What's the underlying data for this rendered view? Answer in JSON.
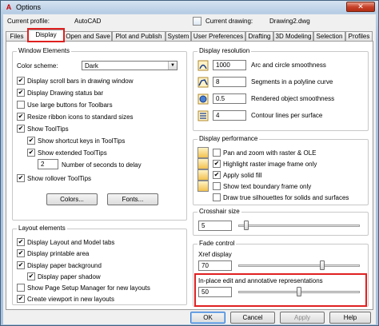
{
  "window": {
    "title": "Options"
  },
  "profile": {
    "current_profile_label": "Current profile:",
    "current_profile_value": "AutoCAD",
    "current_drawing_label": "Current drawing:",
    "current_drawing_value": "Drawing2.dwg"
  },
  "tabs": [
    {
      "label": "Files",
      "active": false
    },
    {
      "label": "Display",
      "active": true
    },
    {
      "label": "Open and Save",
      "active": false
    },
    {
      "label": "Plot and Publish",
      "active": false
    },
    {
      "label": "System",
      "active": false
    },
    {
      "label": "User Preferences",
      "active": false
    },
    {
      "label": "Drafting",
      "active": false
    },
    {
      "label": "3D Modeling",
      "active": false
    },
    {
      "label": "Selection",
      "active": false
    },
    {
      "label": "Profiles",
      "active": false
    }
  ],
  "window_elements": {
    "title": "Window Elements",
    "color_scheme_label": "Color scheme:",
    "color_scheme_value": "Dark",
    "checkboxes": [
      {
        "label": "Display scroll bars in drawing window",
        "checked": true
      },
      {
        "label": "Display Drawing status bar",
        "checked": true
      },
      {
        "label": "Use large buttons for Toolbars",
        "checked": false
      },
      {
        "label": "Resize ribbon icons to standard sizes",
        "checked": true
      },
      {
        "label": "Show ToolTips",
        "checked": true
      },
      {
        "label": "Show shortcut keys in ToolTips",
        "checked": true
      },
      {
        "label": "Show extended ToolTips",
        "checked": true
      },
      {
        "label": "Show rollover ToolTips",
        "checked": true
      }
    ],
    "delay_value": "2",
    "delay_label": "Number of seconds to delay",
    "colors_button": "Colors...",
    "fonts_button": "Fonts..."
  },
  "layout_elements": {
    "title": "Layout elements",
    "checkboxes": [
      {
        "label": "Display Layout and Model tabs",
        "checked": true
      },
      {
        "label": "Display printable area",
        "checked": true
      },
      {
        "label": "Display paper background",
        "checked": true
      },
      {
        "label": "Display paper shadow",
        "checked": true
      },
      {
        "label": "Show Page Setup Manager for new layouts",
        "checked": false
      },
      {
        "label": "Create viewport in new layouts",
        "checked": true
      }
    ]
  },
  "display_resolution": {
    "title": "Display resolution",
    "rows": [
      {
        "value": "1000",
        "label": "Arc and circle smoothness"
      },
      {
        "value": "8",
        "label": "Segments in a polyline curve"
      },
      {
        "value": "0.5",
        "label": "Rendered object smoothness"
      },
      {
        "value": "4",
        "label": "Contour lines per surface"
      }
    ]
  },
  "display_performance": {
    "title": "Display performance",
    "checkboxes": [
      {
        "label": "Pan and zoom with raster & OLE",
        "checked": false
      },
      {
        "label": "Highlight raster image frame only",
        "checked": true
      },
      {
        "label": "Apply solid fill",
        "checked": true
      },
      {
        "label": "Show text boundary frame only",
        "checked": false
      },
      {
        "label": "Draw true silhouettes for solids and surfaces",
        "checked": false
      }
    ]
  },
  "crosshair": {
    "title": "Crosshair size",
    "value": "5",
    "level_percent": 5
  },
  "fade_control": {
    "title": "Fade control",
    "xref_label": "Xref display",
    "xref_value": "70",
    "xref_level_percent": 70,
    "inplace_label": "In-place edit and annotative representations",
    "inplace_value": "50",
    "inplace_level_percent": 50
  },
  "footer": {
    "ok": "OK",
    "cancel": "Cancel",
    "apply": "Apply",
    "help": "Help"
  },
  "colors": {
    "highlight": "#e02020",
    "title_close": "#c7432b"
  }
}
